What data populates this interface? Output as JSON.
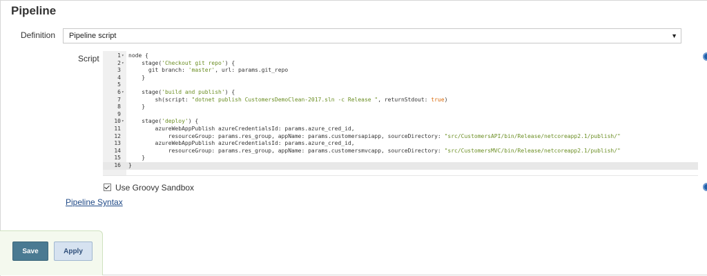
{
  "page": {
    "section_title": "Pipeline"
  },
  "definition": {
    "label": "Definition",
    "selected": "Pipeline script",
    "arrow": "▼"
  },
  "script": {
    "label": "Script",
    "lines": [
      {
        "n": "1",
        "fold": "▾",
        "parts": [
          {
            "t": "node {",
            "c": ""
          }
        ]
      },
      {
        "n": "2",
        "fold": "▾",
        "parts": [
          {
            "t": "    stage(",
            "c": ""
          },
          {
            "t": "'Checkout git repo'",
            "c": "str"
          },
          {
            "t": ") {",
            "c": ""
          }
        ]
      },
      {
        "n": "3",
        "fold": "",
        "parts": [
          {
            "t": "      git branch: ",
            "c": ""
          },
          {
            "t": "'master'",
            "c": "str"
          },
          {
            "t": ", url: params.git_repo",
            "c": ""
          }
        ]
      },
      {
        "n": "4",
        "fold": "",
        "parts": [
          {
            "t": "    }",
            "c": ""
          }
        ]
      },
      {
        "n": "5",
        "fold": "",
        "parts": [
          {
            "t": "",
            "c": ""
          }
        ]
      },
      {
        "n": "6",
        "fold": "▾",
        "parts": [
          {
            "t": "    stage(",
            "c": ""
          },
          {
            "t": "'build and publish'",
            "c": "str"
          },
          {
            "t": ") {",
            "c": ""
          }
        ]
      },
      {
        "n": "7",
        "fold": "",
        "parts": [
          {
            "t": "        sh(script: ",
            "c": ""
          },
          {
            "t": "\"dotnet publish CustomersDemoClean-2017.sln -c Release \"",
            "c": "str"
          },
          {
            "t": ", returnStdout: ",
            "c": ""
          },
          {
            "t": "true",
            "c": "bool"
          },
          {
            "t": ")",
            "c": ""
          }
        ]
      },
      {
        "n": "8",
        "fold": "",
        "parts": [
          {
            "t": "    }",
            "c": ""
          }
        ]
      },
      {
        "n": "9",
        "fold": "",
        "parts": [
          {
            "t": "",
            "c": ""
          }
        ]
      },
      {
        "n": "10",
        "fold": "▾",
        "parts": [
          {
            "t": "    stage(",
            "c": ""
          },
          {
            "t": "'deploy'",
            "c": "str"
          },
          {
            "t": ") {",
            "c": ""
          }
        ]
      },
      {
        "n": "11",
        "fold": "",
        "parts": [
          {
            "t": "        azureWebAppPublish azureCredentialsId: params.azure_cred_id,",
            "c": ""
          }
        ]
      },
      {
        "n": "12",
        "fold": "",
        "parts": [
          {
            "t": "            resourceGroup: params.res_group, appName: params.customersapiapp, sourceDirectory: ",
            "c": ""
          },
          {
            "t": "\"src/CustomersAPI/bin/Release/netcoreapp2.1/publish/\"",
            "c": "str"
          }
        ]
      },
      {
        "n": "13",
        "fold": "",
        "parts": [
          {
            "t": "        azureWebAppPublish azureCredentialsId: params.azure_cred_id,",
            "c": ""
          }
        ]
      },
      {
        "n": "14",
        "fold": "",
        "parts": [
          {
            "t": "            resourceGroup: params.res_group, appName: params.customersmvcapp, sourceDirectory: ",
            "c": ""
          },
          {
            "t": "\"src/CustomersMVC/bin/Release/netcoreapp2.1/publish/\"",
            "c": "str"
          }
        ]
      },
      {
        "n": "15",
        "fold": "",
        "parts": [
          {
            "t": "    }",
            "c": ""
          }
        ]
      },
      {
        "n": "16",
        "fold": "",
        "parts": [
          {
            "t": "}",
            "c": ""
          }
        ],
        "active": true
      }
    ]
  },
  "sandbox": {
    "label": "Use Groovy Sandbox",
    "checked": true
  },
  "syntax_link": "Pipeline Syntax",
  "buttons": {
    "save": "Save",
    "apply": "Apply"
  },
  "colors": {
    "string": "#6b8e23",
    "boolean": "#d96a0a",
    "help_icon": "#1f5fa8",
    "save_button": "#4a7a92"
  }
}
